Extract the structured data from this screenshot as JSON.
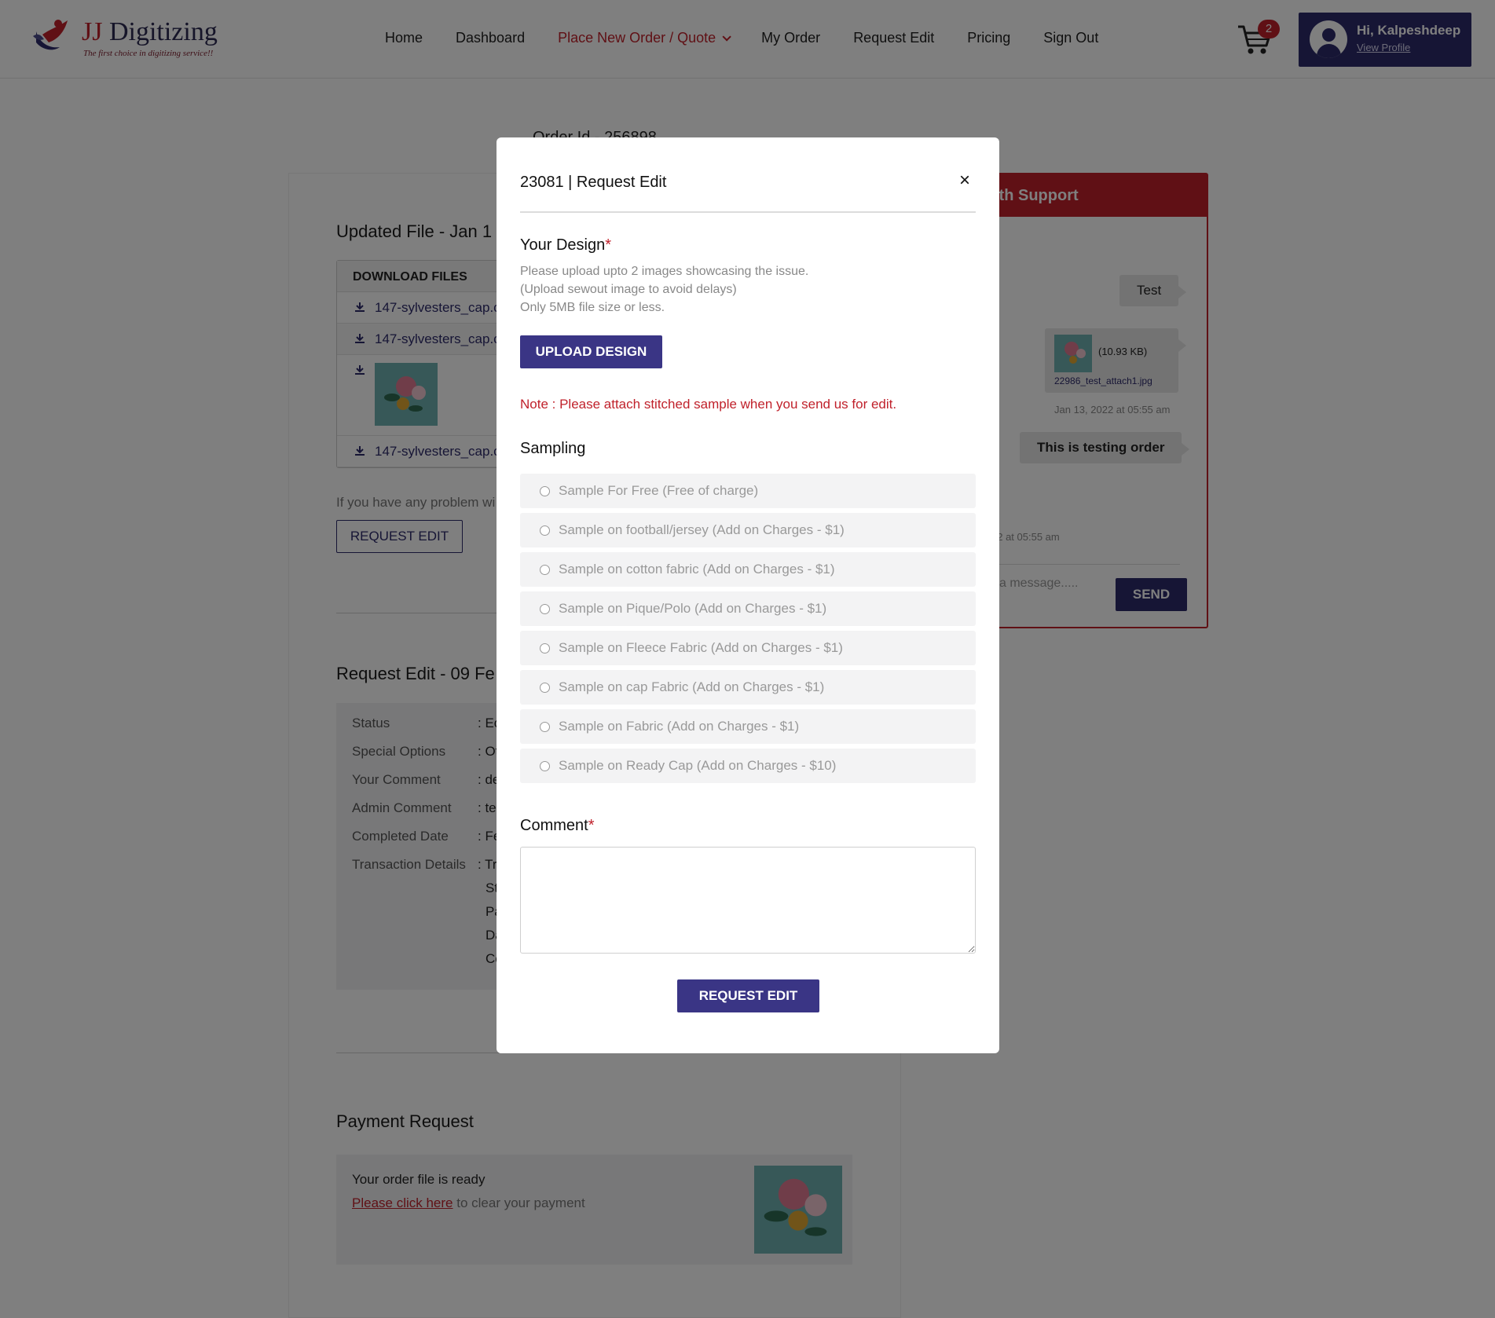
{
  "header": {
    "logo_brand_jj": "JJ",
    "logo_brand_rest": "Digitizing",
    "logo_tagline": "The first choice in digitizing service!!",
    "nav": [
      {
        "label": "Home"
      },
      {
        "label": "Dashboard"
      },
      {
        "label": "Place New Order / Quote"
      },
      {
        "label": "My Order"
      },
      {
        "label": "Request Edit"
      },
      {
        "label": "Pricing"
      },
      {
        "label": "Sign Out"
      }
    ],
    "cart_count": "2",
    "greeting": "Hi, Kalpeshdeep",
    "view_profile": "View Profile"
  },
  "page": {
    "order_id": "Order Id - 256898",
    "updated_file_title": "Updated File - Jan 1",
    "download_header": "DOWNLOAD FILES",
    "files": [
      "147-sylvesters_cap.c",
      "147-sylvesters_cap.c",
      "147-sylvesters_cap.c"
    ],
    "problem_text": "If you have any problem wi",
    "request_edit_button": "REQUEST EDIT",
    "request_edit_title": "Request Edit - 09 Fe",
    "details": [
      {
        "label": "Status",
        "value": ": Ec"
      },
      {
        "label": "Special Options",
        "value": ": Ot"
      },
      {
        "label": "Your Comment",
        "value": ": de"
      },
      {
        "label": "Admin Comment",
        "value": ": te"
      },
      {
        "label": "Completed Date",
        "value": ": Fe"
      },
      {
        "label": "Transaction Details",
        "value": ": Tr"
      }
    ],
    "transaction_lines": [
      "St",
      "Pa",
      "Da",
      "Co"
    ],
    "payment_title": "Payment Request",
    "payment_ready": "Your order file is ready",
    "payment_link": "Please click here",
    "payment_rest": " to clear your payment"
  },
  "chat": {
    "title": "ith Support",
    "msg1": "Test",
    "attach_size": "(10.93 KB)",
    "attach_name": "22986_test_attach1.jpg",
    "attach_time": "Jan 13, 2022  at 05:55 am",
    "msg2": "This is testing order",
    "msg2_time": "22  at 05:55 am",
    "input_placeholder": "a message.....",
    "send_label": "SEND"
  },
  "modal": {
    "title": "23081  |  Request Edit",
    "close": "×",
    "design_label": "Your Design",
    "required_mark": "*",
    "help_lines": [
      "Please upload upto 2 images showcasing the issue.",
      "(Upload sewout image to avoid delays)",
      "Only 5MB file size or less."
    ],
    "upload_label": "UPLOAD DESIGN",
    "note": "Note : Please attach stitched sample when you send us for edit.",
    "sampling_label": "Sampling",
    "sampling_options": [
      "Sample For Free (Free of charge)",
      "Sample on football/jersey (Add on Charges - $1)",
      "Sample on cotton fabric (Add on Charges - $1)",
      "Sample on Pique/Polo (Add on Charges - $1)",
      "Sample on Fleece Fabric (Add on Charges - $1)",
      "Sample on cap Fabric (Add on Charges - $1)",
      "Sample on Fabric (Add on Charges - $1)",
      "Sample on Ready Cap (Add on Charges - $10)"
    ],
    "comment_label": "Comment",
    "comment_value": "",
    "submit_label": "REQUEST EDIT"
  },
  "colors": {
    "brand_navy": "#2d2a6b",
    "accent_red": "#c0212b",
    "overlay": "rgba(0,0,0,0.5)"
  }
}
